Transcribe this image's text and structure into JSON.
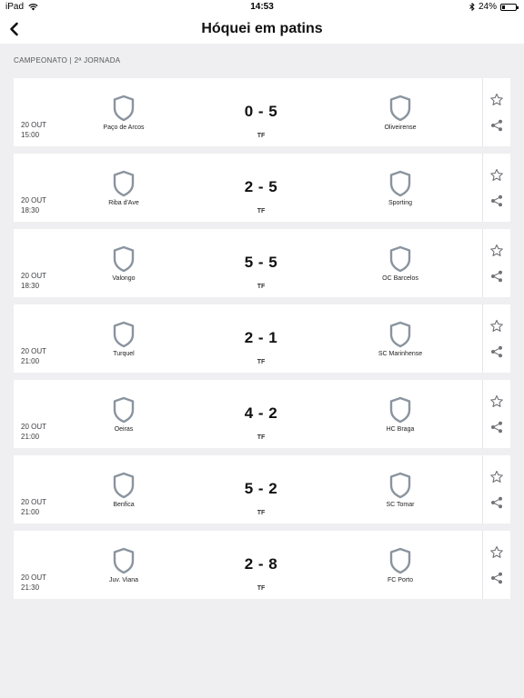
{
  "status_bar": {
    "carrier": "iPad",
    "time": "14:53",
    "battery": "24%",
    "battery_level": 0.24
  },
  "header": {
    "title": "Hóquei em patins"
  },
  "section": {
    "label": "CAMPEONATO | 2ª JORNADA"
  },
  "colors": {
    "shield": "#8a949f",
    "accent": "#111111",
    "icon": "#707378"
  },
  "matches": [
    {
      "date": "20 OUT",
      "time": "15:00",
      "home": "Paço de Arcos",
      "away": "Oliveirense",
      "score": "0 - 5",
      "status": "TF"
    },
    {
      "date": "20 OUT",
      "time": "18:30",
      "home": "Riba d'Ave",
      "away": "Sporting",
      "score": "2 - 5",
      "status": "TF"
    },
    {
      "date": "20 OUT",
      "time": "18:30",
      "home": "Valongo",
      "away": "OC Barcelos",
      "score": "5 - 5",
      "status": "TF"
    },
    {
      "date": "20 OUT",
      "time": "21:00",
      "home": "Turquel",
      "away": "SC Marinhense",
      "score": "2 - 1",
      "status": "TF"
    },
    {
      "date": "20 OUT",
      "time": "21:00",
      "home": "Oeiras",
      "away": "HC Braga",
      "score": "4 - 2",
      "status": "TF"
    },
    {
      "date": "20 OUT",
      "time": "21:00",
      "home": "Benfica",
      "away": "SC Tomar",
      "score": "5 - 2",
      "status": "TF"
    },
    {
      "date": "20 OUT",
      "time": "21:30",
      "home": "Juv. Viana",
      "away": "FC Porto",
      "score": "2 - 8",
      "status": "TF"
    }
  ]
}
